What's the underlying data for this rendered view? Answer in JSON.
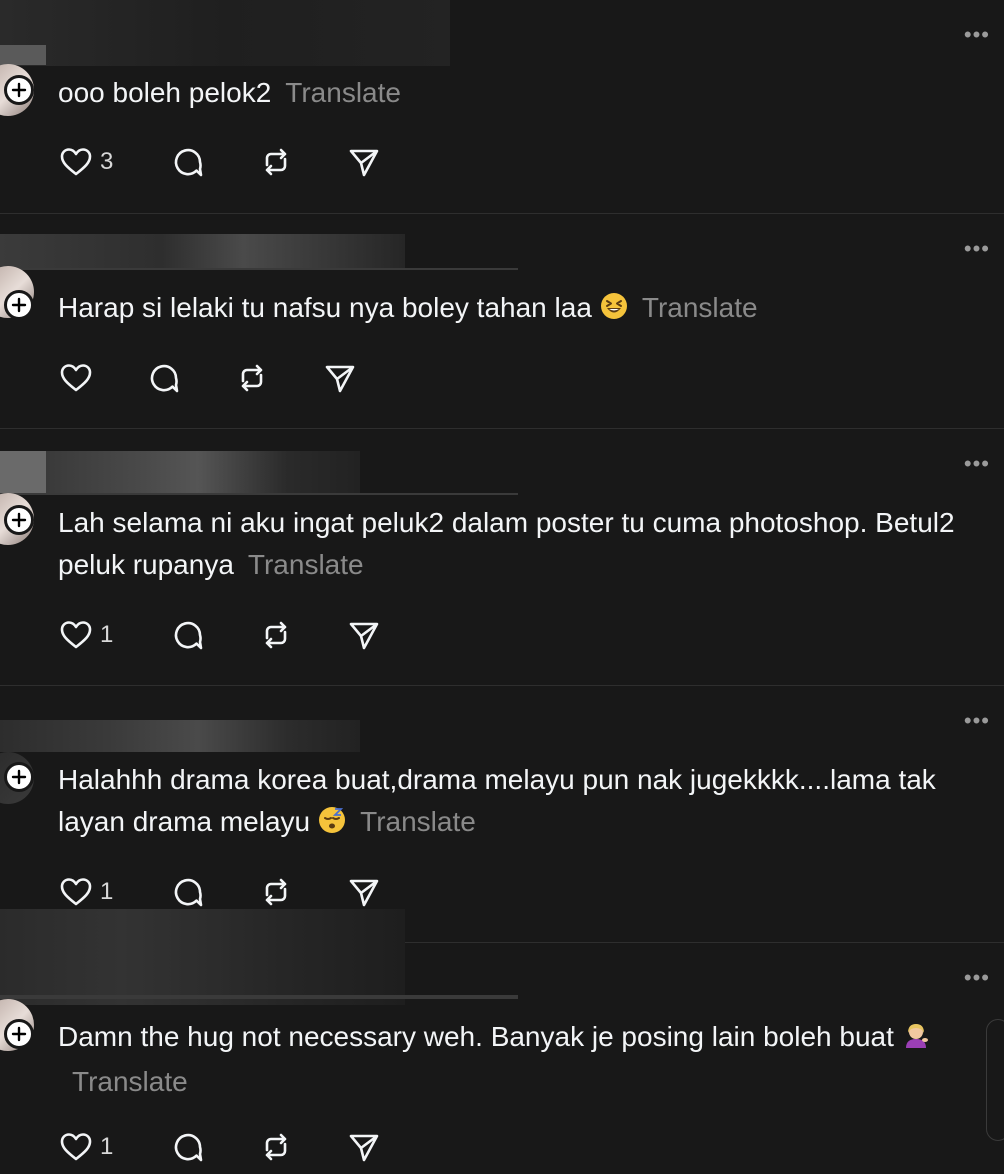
{
  "more_label": "•••",
  "translate_label": "Translate",
  "colors": {
    "background": "#181818",
    "text": "#f3f5f7",
    "muted": "#8a8a8a",
    "divider": "#2e2e2e"
  },
  "posts": [
    {
      "text": "ooo boleh pelok2",
      "emoji": "",
      "likes": "3"
    },
    {
      "text": "Harap si lelaki tu nafsu nya boley tahan laa",
      "emoji": "grinning-squinting-face",
      "likes": ""
    },
    {
      "text": "Lah selama ni aku ingat peluk2 dalam poster tu cuma photoshop. Betul2 peluk rupanya",
      "emoji": "",
      "likes": "1"
    },
    {
      "text": "Halahhh drama korea buat,drama melayu pun nak jugekkkk....lama tak layan drama melayu",
      "emoji": "sleeping-face",
      "likes": "1"
    },
    {
      "text": "Damn the hug not necessary weh. Banyak je posing lain boleh buat",
      "emoji": "person-tipping-hand",
      "likes": "1"
    }
  ],
  "icons": [
    "heart-icon",
    "comment-icon",
    "repost-icon",
    "share-icon",
    "plus-icon",
    "more-icon"
  ]
}
